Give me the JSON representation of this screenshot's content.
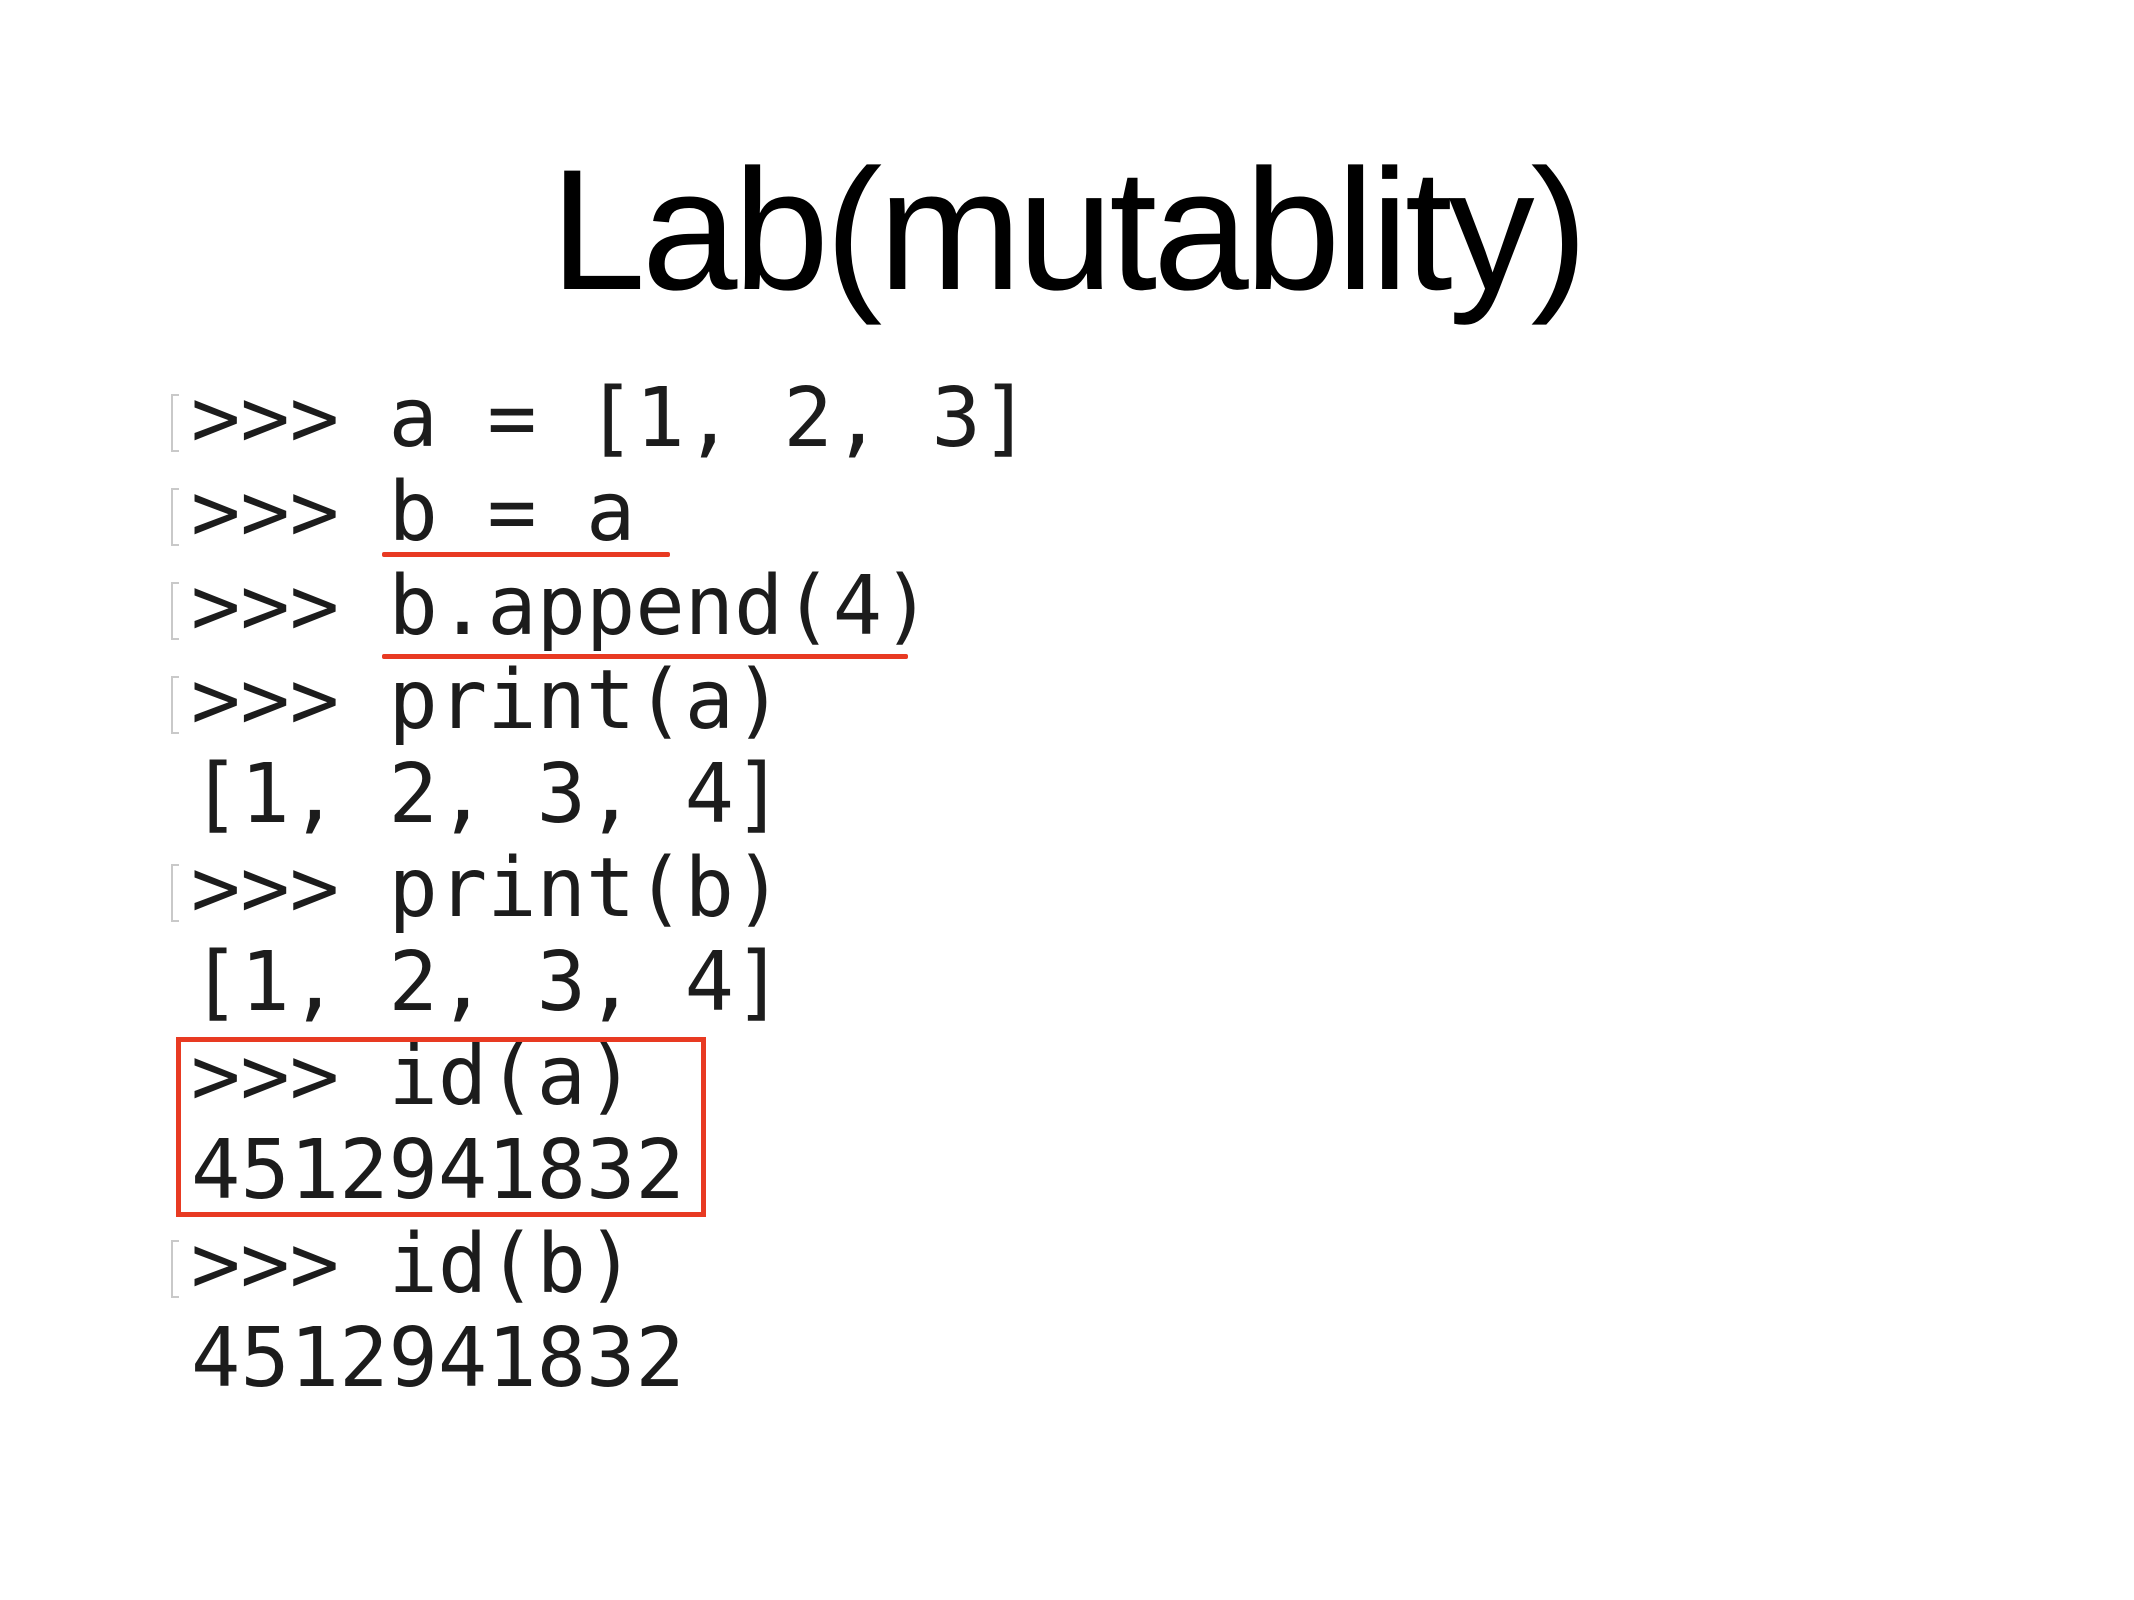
{
  "slide": {
    "title": "Lab(mutablity)"
  },
  "console": {
    "lines": [
      {
        "text": ">>> a = [1, 2, 3]",
        "prompt": true
      },
      {
        "text": ">>> b = a",
        "prompt": true
      },
      {
        "text": ">>> b.append(4)",
        "prompt": true
      },
      {
        "text": ">>> print(a)",
        "prompt": true
      },
      {
        "text": "[1, 2, 3, 4]",
        "prompt": false
      },
      {
        "text": ">>> print(b)",
        "prompt": true
      },
      {
        "text": "[1, 2, 3, 4]",
        "prompt": false
      },
      {
        "text": ">>> id(a)",
        "prompt": false
      },
      {
        "text": "4512941832",
        "prompt": false
      },
      {
        "text": ">>> id(b)",
        "prompt": true
      },
      {
        "text": "4512941832",
        "prompt": false
      }
    ]
  },
  "annotations": {
    "color": "#e83a22"
  }
}
